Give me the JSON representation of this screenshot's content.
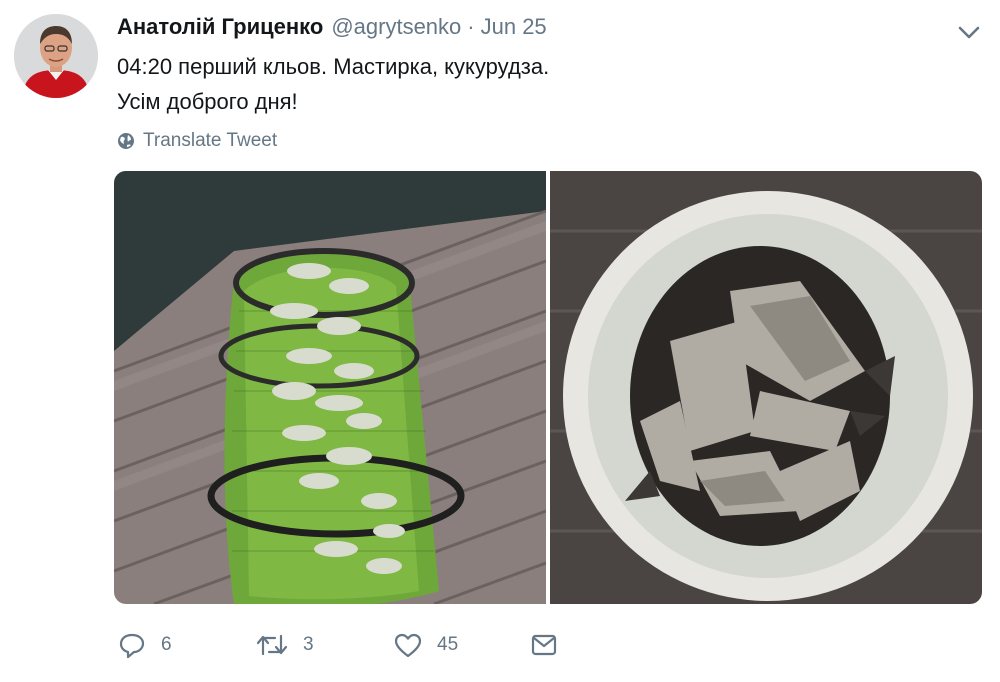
{
  "tweet": {
    "author_name": "Анатолій Гриценко",
    "handle": "@agrytsenko",
    "separator": "·",
    "date": "Jun 25",
    "text_line1": "04:20 перший кльов. Мастирка, кукурудза.",
    "text_line2": "Усім доброго дня!",
    "translate_label": "Translate Tweet"
  },
  "actions": {
    "reply_count": "6",
    "retweet_count": "3",
    "like_count": "45"
  },
  "colors": {
    "text_primary": "#14171a",
    "text_secondary": "#657786"
  },
  "icons": {
    "menu": "chevron-down-icon",
    "translate": "globe-icon",
    "reply": "reply-icon",
    "retweet": "retweet-icon",
    "like": "heart-icon",
    "message": "envelope-icon"
  }
}
